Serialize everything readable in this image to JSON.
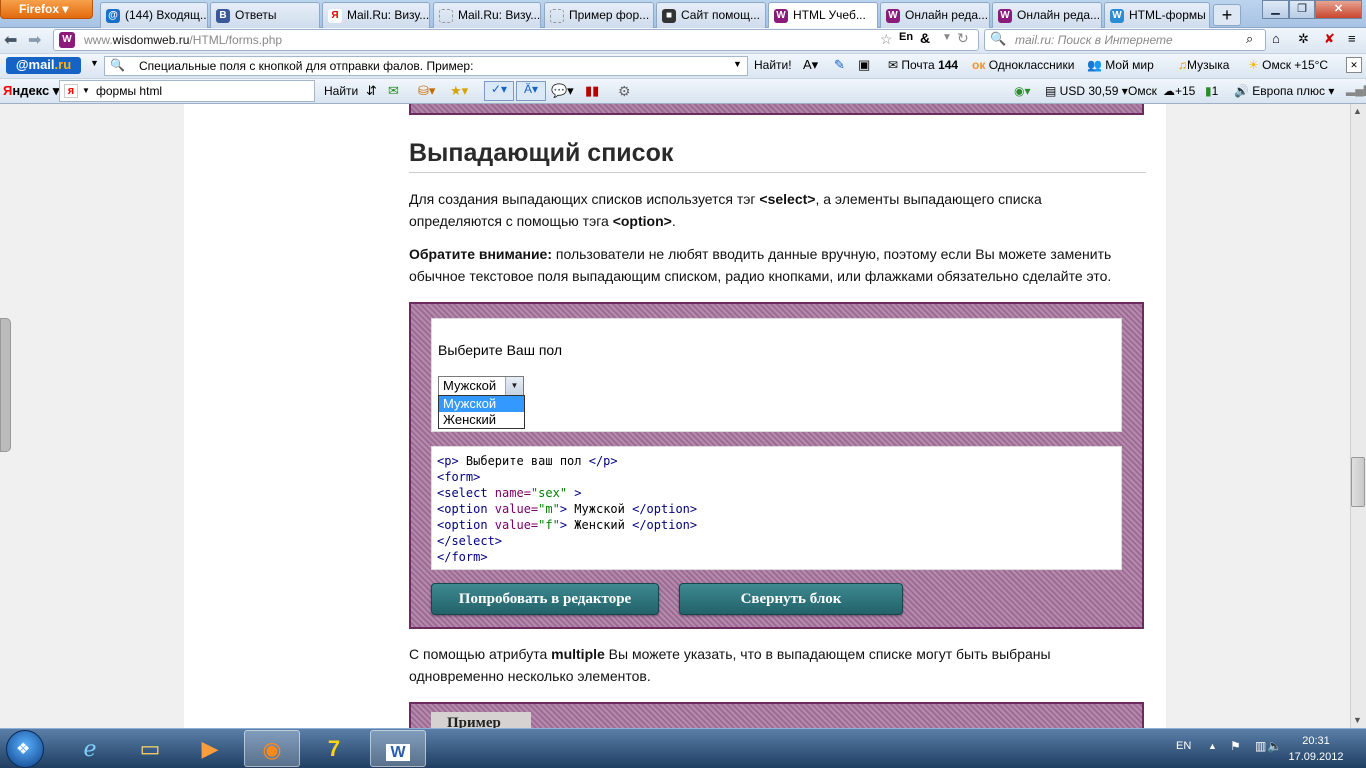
{
  "browser": {
    "menu_label": "Firefox",
    "tabs": [
      {
        "label": "(144) Входящ...",
        "icon": "@",
        "color": "#1a6fc9"
      },
      {
        "label": "Ответы",
        "icon": "B",
        "color": "#3b5998"
      },
      {
        "label": "Mail.Ru: Визу...",
        "icon": "Я",
        "color": "#d00"
      },
      {
        "label": "Mail.Ru: Визу...",
        "icon": "",
        "color": "#bbb"
      },
      {
        "label": "Пример фор...",
        "icon": "",
        "color": "#bbb"
      },
      {
        "label": "Сайт помощ...",
        "icon": "■",
        "color": "#333"
      },
      {
        "label": "HTML Учеб...",
        "icon": "W",
        "color": "#8b1a7a"
      },
      {
        "label": "Онлайн реда...",
        "icon": "W",
        "color": "#8b1a7a"
      },
      {
        "label": "Онлайн реда...",
        "icon": "W",
        "color": "#8b1a7a"
      },
      {
        "label": "HTML-формы",
        "icon": "W",
        "color": "#2a8bd6"
      }
    ],
    "url_prefix": "www.",
    "url_domain": "wisdomweb.ru",
    "url_path": "/HTML/forms.php",
    "search_placeholder": "mail.ru: Поиск в Интернете",
    "lang_indicator": "En"
  },
  "mail_toolbar": {
    "logo_left": "@mail",
    "logo_right": ".ru",
    "search_value": "Специальные поля с кнопкой для отправки фалов. Пример:",
    "find_label": "Найти!",
    "mail_label": "Почта",
    "mail_count": "144",
    "ok_label": "Одноклассники",
    "mymir_label": "Мой мир",
    "music_label": "Музыка",
    "weather": "Омск +15°C"
  },
  "yandex_toolbar": {
    "logo_y": "Я",
    "logo_rest": "ндекс",
    "search_value": "формы html",
    "find_label": "Найти",
    "currency": "USD 30,59",
    "city": "Омск",
    "temp": "+15",
    "count": "1",
    "radio": "Европа плюс"
  },
  "page": {
    "heading": "Выпадающий список",
    "intro_1": "Для создания выпадающих списков используется тэг ",
    "intro_tag1": "<select>",
    "intro_2": ", а элементы выпадающего списка",
    "intro_3": "определяются с помощью тэга ",
    "intro_tag2": "<option>",
    "intro_4": ".",
    "note_bold": "Обратите внимание:",
    "note_1": " пользователи не любят вводить данные вручную, поэтому если Вы можете заменить",
    "note_2": "обычное текстовое поля выпадающим списком, радио кнопками, или флажками обязательно сделайте это.",
    "example": {
      "prompt": "Выберите Ваш пол",
      "selected": "Мужской",
      "options": [
        "Мужской",
        "Женский"
      ]
    },
    "code": {
      "l1_open": "<p>",
      "l1_text": " Выберите ваш пол ",
      "l1_close": "</p>",
      "l2": "<form>",
      "l3_tag": "<select ",
      "l3_attr": "name=",
      "l3_val": "\"sex\"",
      "l3_end": " >",
      "l4_tag": "<option ",
      "l4_attr": "value=",
      "l4_val": "\"m\"",
      "l4_gt": ">",
      "l4_text": " Мужской ",
      "l4_close": "</option>",
      "l5_tag": "<option ",
      "l5_attr": "value=",
      "l5_val": "\"f\"",
      "l5_gt": ">",
      "l5_text": " Женский ",
      "l5_close": "</option>",
      "l6": "</select>",
      "l7": "</form>"
    },
    "try_button": "Попробовать в редакторе",
    "collapse_button": "Свернуть блок",
    "multiple_1": "С помощью атрибута ",
    "multiple_bold": "multiple",
    "multiple_2": " Вы можете указать, что в выпадающем списке могут быть выбраны",
    "multiple_3": "одновременно несколько элементов.",
    "next_example_tab": "Пример"
  },
  "taskbar": {
    "lang": "EN",
    "time": "20:31",
    "date": "17.09.2012"
  }
}
